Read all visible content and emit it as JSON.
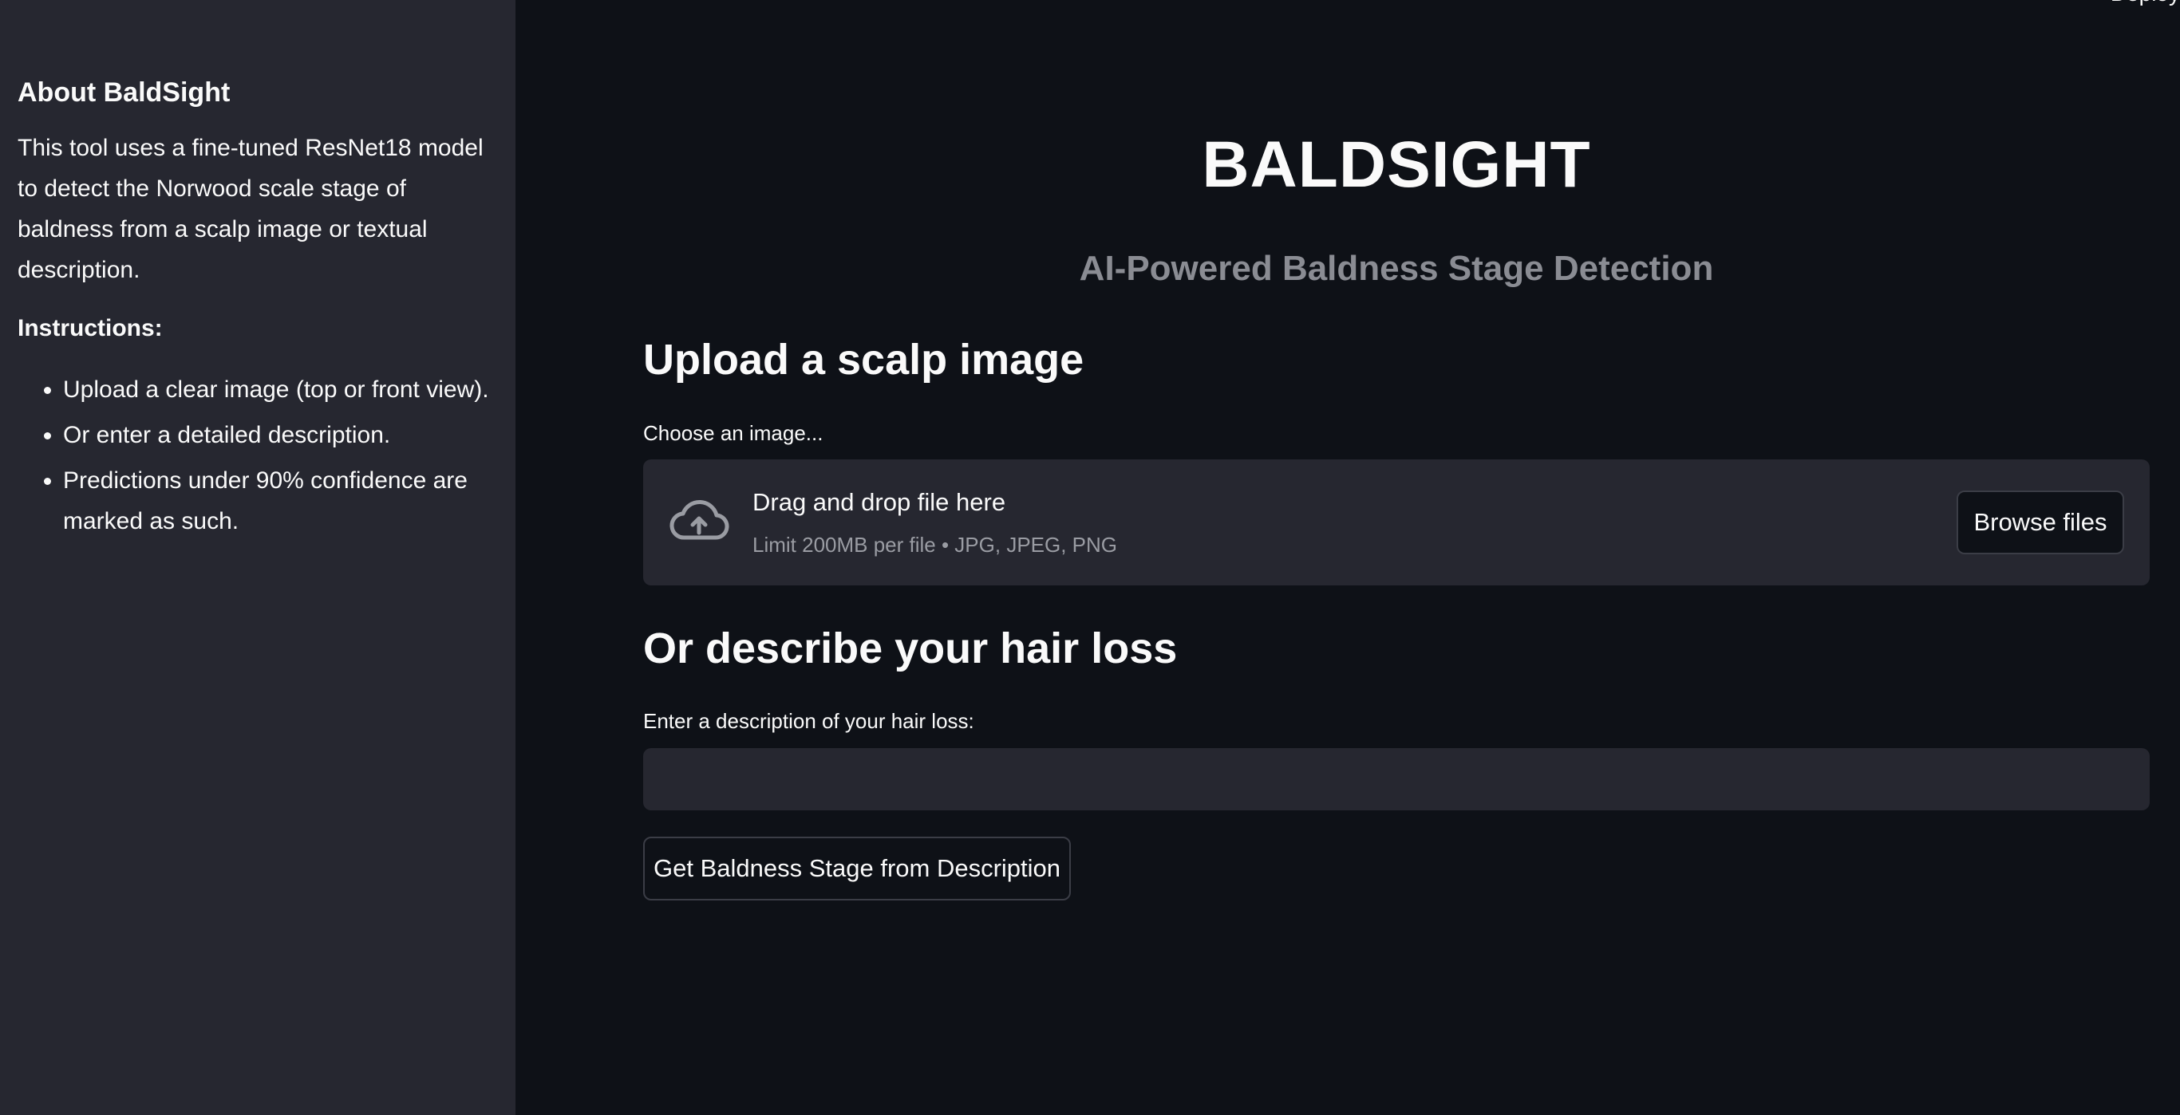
{
  "sidebar": {
    "heading": "About BaldSight",
    "description": "This tool uses a fine-tuned ResNet18 model to detect the Norwood scale stage of baldness from a scalp image or textual description.",
    "instructions_heading": "Instructions:",
    "instructions": [
      "Upload a clear image (top or front view).",
      "Or enter a detailed description.",
      "Predictions under 90% confidence are marked as such."
    ]
  },
  "header": {
    "deploy_label": "Deploy"
  },
  "main": {
    "title": "BALDSIGHT",
    "subtitle": "AI-Powered Baldness Stage Detection",
    "upload_section": {
      "heading": "Upload a scalp image",
      "label": "Choose an image...",
      "dropzone_text": "Drag and drop file here",
      "dropzone_limit": "Limit 200MB per file • JPG, JPEG, PNG",
      "browse_label": "Browse files",
      "icon": "cloud-upload-icon"
    },
    "describe_section": {
      "heading": "Or describe your hair loss",
      "label": "Enter a description of your hair loss:",
      "input_value": "",
      "button_label": "Get Baldness Stage from Description"
    }
  },
  "colors": {
    "background": "#0e1117",
    "sidebar_bg": "#262730",
    "text": "#fafafa",
    "muted": "#8a8c93"
  }
}
